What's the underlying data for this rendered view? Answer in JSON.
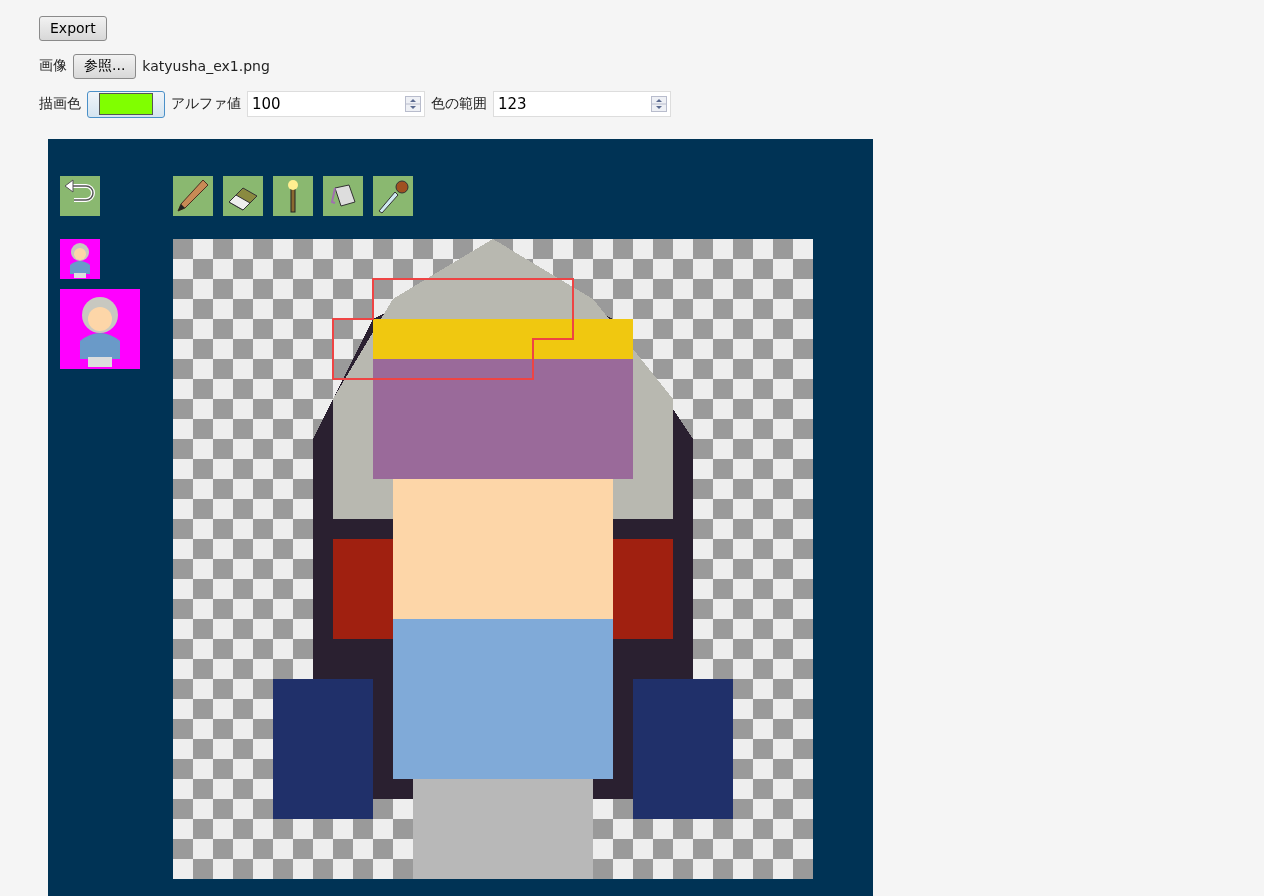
{
  "export_button": {
    "label": "Export"
  },
  "image_row": {
    "label": "画像",
    "browse_button": "参照...",
    "file_name": "katyusha_ex1.png"
  },
  "options_row": {
    "color_label": "描画色",
    "color": "#80ff00",
    "alpha_label": "アルファ値",
    "alpha_value": "100",
    "range_label": "色の範囲",
    "range_value": "123"
  }
}
